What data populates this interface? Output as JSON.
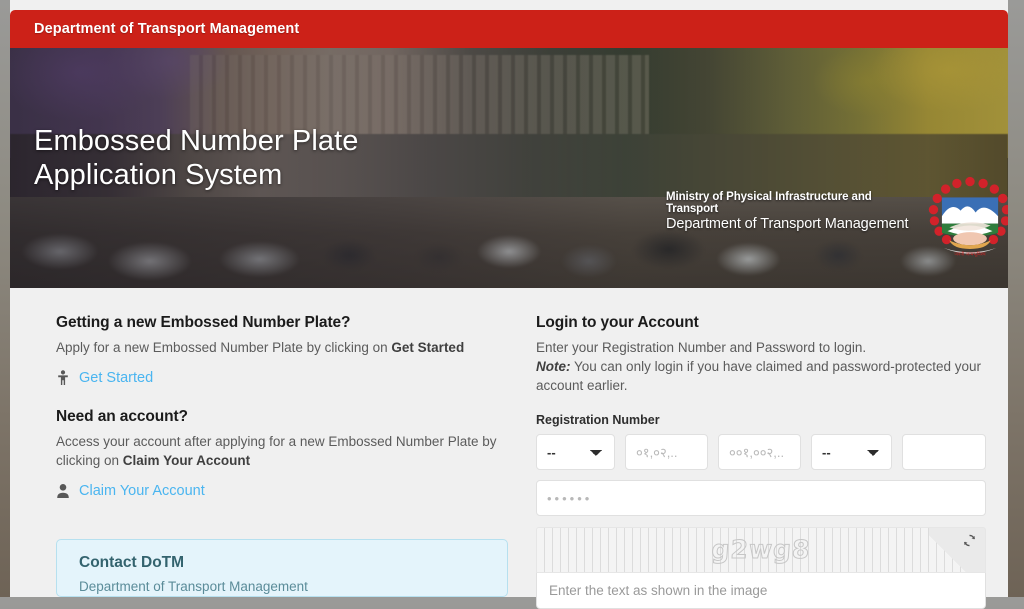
{
  "topbar": {
    "title": "Department of Transport Management"
  },
  "hero": {
    "title": "Embossed Number Plate Application System",
    "ministry_line1": "Ministry of Physical Infrastructure and Transport",
    "ministry_line2": "Department of Transport Management",
    "emblem_name": "nepal-government-emblem"
  },
  "left": {
    "new_plate": {
      "heading": "Getting a new Embossed Number Plate?",
      "body_prefix": "Apply for a new Embossed Number Plate by clicking on ",
      "body_strong": "Get Started",
      "link_label": "Get Started",
      "link_icon": "person-icon"
    },
    "need_account": {
      "heading": "Need an account?",
      "body_prefix": "Access your account after applying for a new Embossed Number Plate by clicking on ",
      "body_strong": "Claim Your Account",
      "link_label": "Claim Your Account",
      "link_icon": "user-icon"
    },
    "contact": {
      "title": "Contact DoTM",
      "subtitle": "Department of Transport Management"
    }
  },
  "login": {
    "heading": "Login to your Account",
    "intro": "Enter your Registration Number and Password to login.",
    "note_label": "Note:",
    "note_text": " You can only login if you have claimed and password-protected your account earlier.",
    "registration_label": "Registration Number",
    "fields": {
      "state_value": "--",
      "state_options": [
        "--"
      ],
      "office_placeholder": "०१,०२,..",
      "lot_placeholder": "००१,००२,..",
      "type_value": "--",
      "type_options": [
        "--"
      ],
      "number_placeholder": "",
      "number_value": ""
    },
    "password_placeholder": "••••••",
    "captcha": {
      "text": "g2wg8",
      "refresh_icon": "refresh-icon",
      "input_placeholder": "Enter the text as shown in the image"
    }
  },
  "colors": {
    "brand_red": "#cc2118",
    "link_blue": "#4ab5f0",
    "page_bg": "#f0f0f0",
    "contact_bg": "#e4f4fb"
  }
}
